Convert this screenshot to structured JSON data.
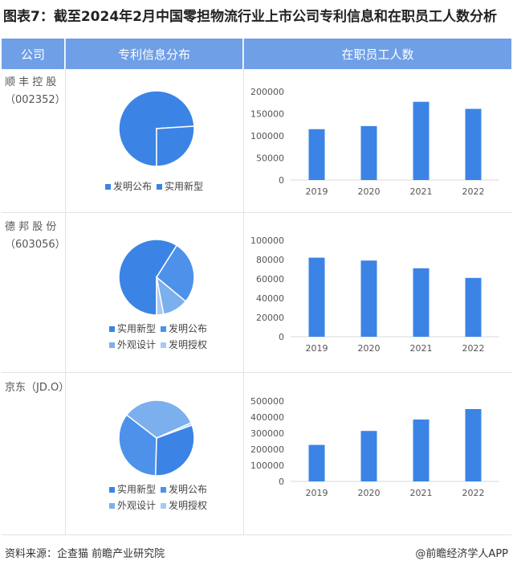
{
  "title": "图表7：截至2024年2月中国零担物流行业上市公司专利信息和在职员工人数分析",
  "header": {
    "col_company": "公司",
    "col_patent": "专利信息分布",
    "col_staff": "在职员工人数"
  },
  "rows": [
    {
      "name": "顺 丰 控 股",
      "code": "（002352）"
    },
    {
      "name": "德 邦 股 份",
      "code": "（603056）"
    },
    {
      "name": "京东（JD.O）",
      "code": ""
    }
  ],
  "legend_labels": {
    "fabu": "发明公布",
    "xinxing": "实用新型",
    "waiguan": "外观设计",
    "shouquan": "发明授权"
  },
  "colors": {
    "header": "#6f9fe6",
    "bar": "#3b84e5",
    "pie_main": "#3b84e5",
    "pie_mid": "#4d91ea",
    "pie_light": "#7cafee",
    "pie_pale": "#a9c9f3"
  },
  "footer": {
    "source": "资料来源：企查猫 前瞻产业研究院",
    "brand": "@前瞻经济学人APP"
  },
  "chart_data": [
    {
      "type": "pie",
      "company": "顺丰控股",
      "slices": [
        {
          "label": "发明公布",
          "value": 74
        },
        {
          "label": "实用新型",
          "value": 26
        }
      ]
    },
    {
      "type": "bar",
      "company": "顺丰控股",
      "categories": [
        "2019",
        "2020",
        "2021",
        "2022"
      ],
      "values": [
        115000,
        122000,
        177000,
        161000
      ],
      "ylim": [
        0,
        200000
      ],
      "yticks": [
        "0",
        "50000",
        "100000",
        "150000",
        "200000"
      ],
      "tickvals": [
        0,
        50000,
        100000,
        150000,
        200000
      ]
    },
    {
      "type": "pie",
      "company": "德邦股份",
      "slices": [
        {
          "label": "实用新型",
          "value": 59
        },
        {
          "label": "发明公布",
          "value": 27
        },
        {
          "label": "外观设计",
          "value": 11
        },
        {
          "label": "发明授权",
          "value": 3
        }
      ]
    },
    {
      "type": "bar",
      "company": "德邦股份",
      "categories": [
        "2019",
        "2020",
        "2021",
        "2022"
      ],
      "values": [
        82000,
        79000,
        71000,
        61000
      ],
      "ylim": [
        0,
        100000
      ],
      "yticks": [
        "0",
        "20000",
        "40000",
        "60000",
        "80000",
        "100000"
      ],
      "tickvals": [
        0,
        20000,
        40000,
        60000,
        80000,
        100000
      ]
    },
    {
      "type": "pie",
      "company": "京东",
      "slices": [
        {
          "label": "实用新型",
          "value": 31
        },
        {
          "label": "发明公布",
          "value": 35
        },
        {
          "label": "外观设计",
          "value": 33
        },
        {
          "label": "发明授权",
          "value": 1
        }
      ]
    },
    {
      "type": "bar",
      "company": "京东",
      "categories": [
        "2019",
        "2020",
        "2021",
        "2022"
      ],
      "values": [
        227000,
        314000,
        385000,
        450000
      ],
      "ylim": [
        0,
        500000
      ],
      "yticks": [
        "0",
        "100000",
        "200000",
        "300000",
        "400000",
        "500000"
      ],
      "tickvals": [
        0,
        100000,
        200000,
        300000,
        400000,
        500000
      ]
    }
  ]
}
